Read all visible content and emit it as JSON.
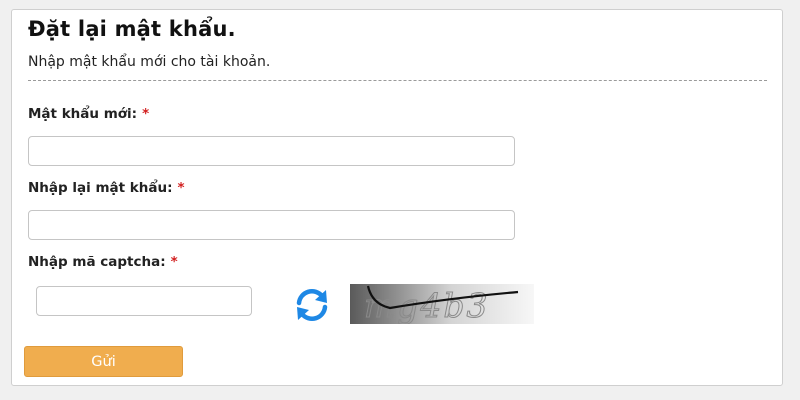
{
  "form": {
    "title": "Đặt lại mật khẩu.",
    "subtitle": "Nhập mật khẩu mới cho tài khoản.",
    "required_mark": "*",
    "fields": {
      "new_password": {
        "label": "Mật khẩu mới:",
        "value": ""
      },
      "confirm_password": {
        "label": "Nhập lại mật khẩu:",
        "value": ""
      },
      "captcha": {
        "label": "Nhập mã captcha:",
        "value": ""
      }
    },
    "captcha_text": "mg4b3",
    "submit_label": "Gửi"
  },
  "colors": {
    "submit_button": "#f0ad4e",
    "required_mark": "#d21f1f",
    "refresh_icon": "#1e88e5"
  },
  "icons": {
    "refresh": "refresh-icon"
  }
}
